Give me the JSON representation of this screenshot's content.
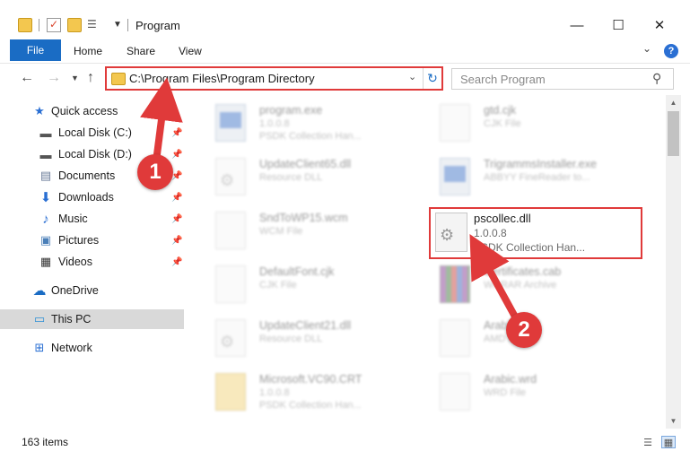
{
  "window": {
    "title": "Program",
    "controls": {
      "minimize": "—",
      "maximize": "☐",
      "close": "✕"
    }
  },
  "ribbon": {
    "tabs": [
      "File",
      "Home",
      "Share",
      "View"
    ],
    "help": "?"
  },
  "nav": {
    "address": "C:\\Program Files\\Program Directory",
    "search_placeholder": "Search Program"
  },
  "sidebar": {
    "items": [
      {
        "label": "Quick access",
        "icon": "star-icon"
      },
      {
        "label": "Local Disk (C:)",
        "icon": "drive-icon",
        "pinned": true
      },
      {
        "label": "Local Disk (D:)",
        "icon": "drive-icon",
        "pinned": true
      },
      {
        "label": "Documents",
        "icon": "documents-icon",
        "pinned": true
      },
      {
        "label": "Downloads",
        "icon": "downloads-icon",
        "pinned": true
      },
      {
        "label": "Music",
        "icon": "music-icon",
        "pinned": true
      },
      {
        "label": "Pictures",
        "icon": "pictures-icon",
        "pinned": true
      },
      {
        "label": "Videos",
        "icon": "videos-icon",
        "pinned": true
      },
      {
        "label": "OneDrive",
        "icon": "cloud-icon"
      },
      {
        "label": "This PC",
        "icon": "computer-icon",
        "selected": true
      },
      {
        "label": "Network",
        "icon": "network-icon"
      }
    ]
  },
  "files": [
    {
      "name": "program.exe",
      "line1": "1.0.0.8",
      "line2": "PSDK Collection Han...",
      "icon": "exe-file-icon"
    },
    {
      "name": "gtd.cjk",
      "line1": "CJK File",
      "line2": "",
      "icon": "document-icon"
    },
    {
      "name": "UpdateClient65.dll",
      "line1": "Resource DLL",
      "line2": "",
      "icon": "dll-file-icon"
    },
    {
      "name": "TrigrammsInstaller.exe",
      "line1": "ABBYY FineReader to...",
      "line2": "",
      "icon": "installer-icon"
    },
    {
      "name": "SndToWP15.wcm",
      "line1": "WCM File",
      "line2": "",
      "icon": "document-icon"
    },
    {
      "name": "DefaultFont.cjk",
      "line1": "CJK File",
      "line2": "",
      "icon": "document-icon"
    },
    {
      "name": "Certificates.cab",
      "line1": "WinRAR Archive",
      "line2": "",
      "icon": "archive-icon"
    },
    {
      "name": "UpdateClient21.dll",
      "line1": "Resource DLL",
      "line2": "",
      "icon": "dll-file-icon"
    },
    {
      "name": "Arabic.amd",
      "line1": "AMD File",
      "line2": "",
      "icon": "document-icon"
    },
    {
      "name": "Microsoft.VC90.CRT",
      "line1": "1.0.0.8",
      "line2": "PSDK Collection Han...",
      "icon": "folder-file-icon"
    },
    {
      "name": "Arabic.wrd",
      "line1": "WRD File",
      "line2": "",
      "icon": "document-icon"
    }
  ],
  "highlighted_file": {
    "name": "pscollec.dll",
    "version": "1.0.0.8",
    "description": "PSDK Collection Han..."
  },
  "status": {
    "count": "163 items"
  },
  "annotations": {
    "step1": "1",
    "step2": "2",
    "color": "#e03a3a"
  },
  "colors": {
    "accent": "#1a6cc4",
    "highlight": "#e03a3a",
    "selected_bg": "#d9d9d9"
  }
}
